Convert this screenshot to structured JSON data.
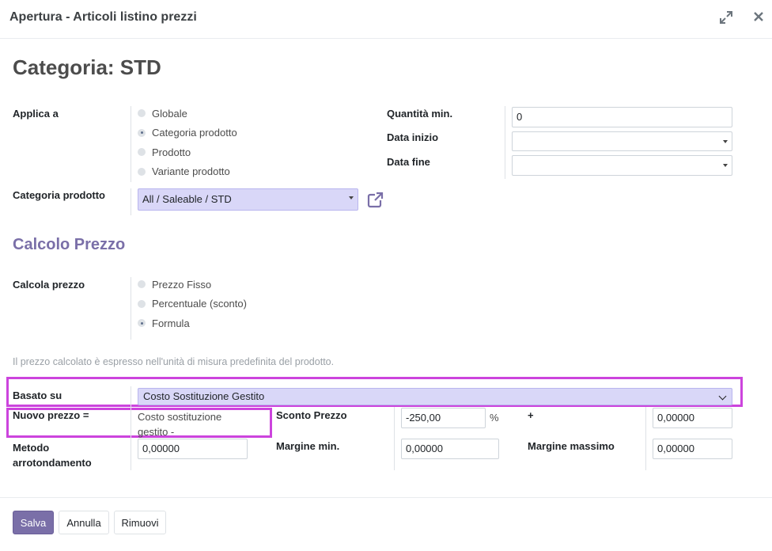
{
  "modal": {
    "title": "Apertura - Articoli listino prezzi",
    "expand_icon": "expand-icon",
    "close_icon": "close-icon"
  },
  "record": {
    "title": "Categoria: STD"
  },
  "apply_on": {
    "label": "Applica a",
    "options": [
      "Globale",
      "Categoria prodotto",
      "Prodotto",
      "Variante prodotto"
    ],
    "selected": "Categoria prodotto"
  },
  "product_category": {
    "label": "Categoria prodotto",
    "value": "All / Saleable / STD",
    "external_icon": "external-link-icon"
  },
  "min_quantity": {
    "label": "Quantità min.",
    "value": "0"
  },
  "date_start": {
    "label": "Data inizio",
    "value": ""
  },
  "date_end": {
    "label": "Data fine",
    "value": ""
  },
  "price_section": {
    "title": "Calcolo Prezzo"
  },
  "compute_price": {
    "label": "Calcola prezzo",
    "options": [
      "Prezzo Fisso",
      "Percentuale (sconto)",
      "Formula"
    ],
    "selected": "Formula"
  },
  "help_text": "Il prezzo calcolato è espresso nell'unità di misura predefinita del prodotto.",
  "base": {
    "label": "Basato su",
    "value": "Costo Sostituzione Gestito"
  },
  "new_price": {
    "label": "Nuovo prezzo =",
    "value_line1": "Costo sostituzione",
    "value_line2": "gestito -"
  },
  "price_discount": {
    "label": "Sconto Prezzo",
    "value": "-250,00",
    "unit": "%"
  },
  "price_surcharge": {
    "label": "+",
    "value": "0,00000"
  },
  "rounding": {
    "label_line1": "Metodo",
    "label_line2": "arrotondamento",
    "value": "0,00000"
  },
  "min_margin": {
    "label": "Margine min.",
    "value": "0,00000"
  },
  "max_margin": {
    "label": "Margine massimo",
    "value": "0,00000"
  },
  "buttons": {
    "save": "Salva",
    "discard": "Annulla",
    "remove": "Rimuovi"
  },
  "colors": {
    "primary": "#7a6fa8",
    "highlight": "#cc44dd",
    "select_bg": "#d9d7f8"
  }
}
